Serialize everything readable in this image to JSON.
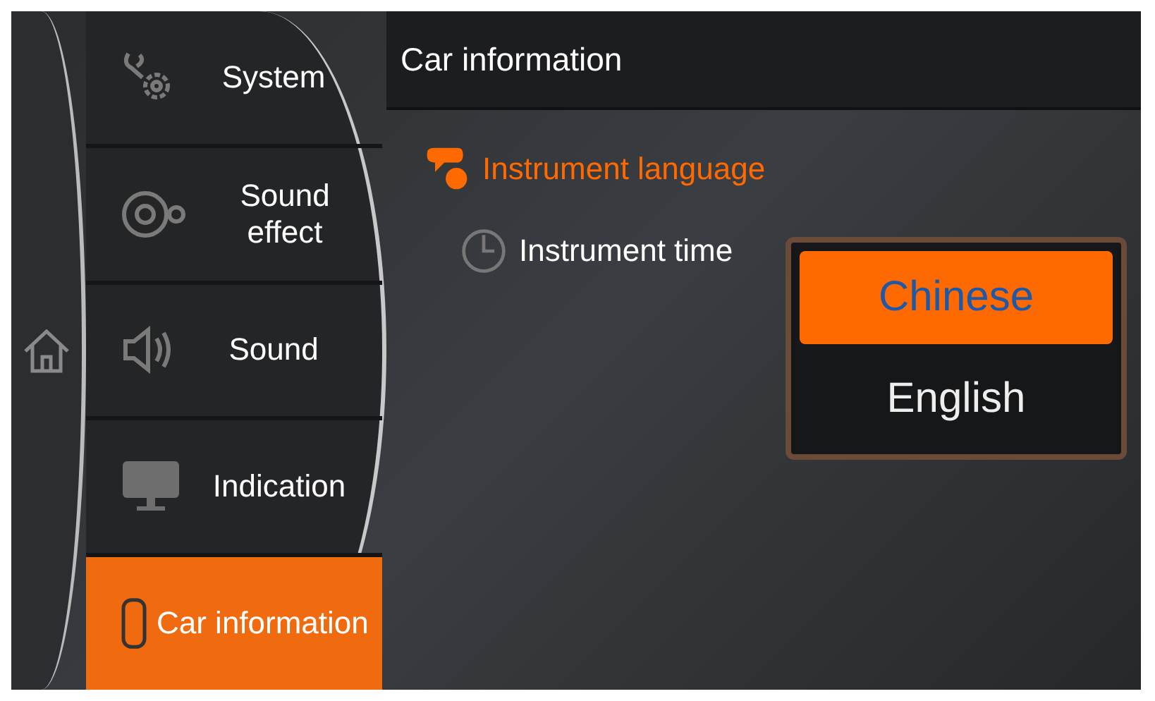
{
  "header": {
    "title": "Car information"
  },
  "menu": [
    {
      "label": "System",
      "selected": false
    },
    {
      "label": "Sound effect",
      "selected": false
    },
    {
      "label": "Sound",
      "selected": false
    },
    {
      "label": "Indication",
      "selected": false
    },
    {
      "label": "Car information",
      "selected": true
    }
  ],
  "settings": [
    {
      "label": "Instrument language",
      "selected": true
    },
    {
      "label": "Instrument time",
      "selected": false
    }
  ],
  "language_options": [
    {
      "label": "Chinese",
      "selected": true
    },
    {
      "label": "English",
      "selected": false
    }
  ]
}
